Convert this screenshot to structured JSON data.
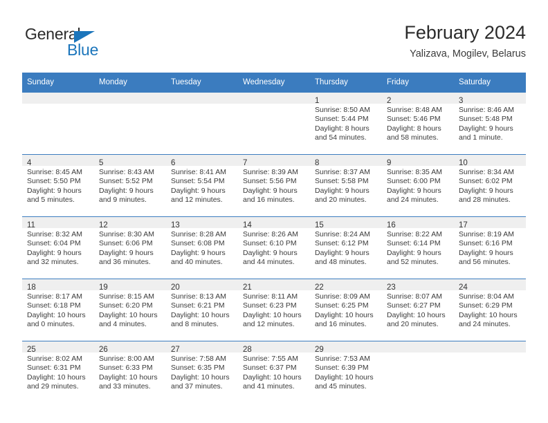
{
  "logo": {
    "word1": "General",
    "word2": "Blue",
    "triangle_color": "#1b75bb",
    "word1_color": "#2b2b2b",
    "word2_color": "#1b75bb"
  },
  "header": {
    "title": "February 2024",
    "subtitle": "Yalizava, Mogilev, Belarus"
  },
  "colors": {
    "header_blue": "#3b7cbf",
    "row_band_gray": "#efefef",
    "text": "#3a3a3a"
  },
  "weekdays": [
    "Sunday",
    "Monday",
    "Tuesday",
    "Wednesday",
    "Thursday",
    "Friday",
    "Saturday"
  ],
  "weeks": [
    [
      {
        "day": "",
        "sunrise": "",
        "sunset": "",
        "daylight1": "",
        "daylight2": ""
      },
      {
        "day": "",
        "sunrise": "",
        "sunset": "",
        "daylight1": "",
        "daylight2": ""
      },
      {
        "day": "",
        "sunrise": "",
        "sunset": "",
        "daylight1": "",
        "daylight2": ""
      },
      {
        "day": "",
        "sunrise": "",
        "sunset": "",
        "daylight1": "",
        "daylight2": ""
      },
      {
        "day": "1",
        "sunrise": "Sunrise: 8:50 AM",
        "sunset": "Sunset: 5:44 PM",
        "daylight1": "Daylight: 8 hours",
        "daylight2": "and 54 minutes."
      },
      {
        "day": "2",
        "sunrise": "Sunrise: 8:48 AM",
        "sunset": "Sunset: 5:46 PM",
        "daylight1": "Daylight: 8 hours",
        "daylight2": "and 58 minutes."
      },
      {
        "day": "3",
        "sunrise": "Sunrise: 8:46 AM",
        "sunset": "Sunset: 5:48 PM",
        "daylight1": "Daylight: 9 hours",
        "daylight2": "and 1 minute."
      }
    ],
    [
      {
        "day": "4",
        "sunrise": "Sunrise: 8:45 AM",
        "sunset": "Sunset: 5:50 PM",
        "daylight1": "Daylight: 9 hours",
        "daylight2": "and 5 minutes."
      },
      {
        "day": "5",
        "sunrise": "Sunrise: 8:43 AM",
        "sunset": "Sunset: 5:52 PM",
        "daylight1": "Daylight: 9 hours",
        "daylight2": "and 9 minutes."
      },
      {
        "day": "6",
        "sunrise": "Sunrise: 8:41 AM",
        "sunset": "Sunset: 5:54 PM",
        "daylight1": "Daylight: 9 hours",
        "daylight2": "and 12 minutes."
      },
      {
        "day": "7",
        "sunrise": "Sunrise: 8:39 AM",
        "sunset": "Sunset: 5:56 PM",
        "daylight1": "Daylight: 9 hours",
        "daylight2": "and 16 minutes."
      },
      {
        "day": "8",
        "sunrise": "Sunrise: 8:37 AM",
        "sunset": "Sunset: 5:58 PM",
        "daylight1": "Daylight: 9 hours",
        "daylight2": "and 20 minutes."
      },
      {
        "day": "9",
        "sunrise": "Sunrise: 8:35 AM",
        "sunset": "Sunset: 6:00 PM",
        "daylight1": "Daylight: 9 hours",
        "daylight2": "and 24 minutes."
      },
      {
        "day": "10",
        "sunrise": "Sunrise: 8:34 AM",
        "sunset": "Sunset: 6:02 PM",
        "daylight1": "Daylight: 9 hours",
        "daylight2": "and 28 minutes."
      }
    ],
    [
      {
        "day": "11",
        "sunrise": "Sunrise: 8:32 AM",
        "sunset": "Sunset: 6:04 PM",
        "daylight1": "Daylight: 9 hours",
        "daylight2": "and 32 minutes."
      },
      {
        "day": "12",
        "sunrise": "Sunrise: 8:30 AM",
        "sunset": "Sunset: 6:06 PM",
        "daylight1": "Daylight: 9 hours",
        "daylight2": "and 36 minutes."
      },
      {
        "day": "13",
        "sunrise": "Sunrise: 8:28 AM",
        "sunset": "Sunset: 6:08 PM",
        "daylight1": "Daylight: 9 hours",
        "daylight2": "and 40 minutes."
      },
      {
        "day": "14",
        "sunrise": "Sunrise: 8:26 AM",
        "sunset": "Sunset: 6:10 PM",
        "daylight1": "Daylight: 9 hours",
        "daylight2": "and 44 minutes."
      },
      {
        "day": "15",
        "sunrise": "Sunrise: 8:24 AM",
        "sunset": "Sunset: 6:12 PM",
        "daylight1": "Daylight: 9 hours",
        "daylight2": "and 48 minutes."
      },
      {
        "day": "16",
        "sunrise": "Sunrise: 8:22 AM",
        "sunset": "Sunset: 6:14 PM",
        "daylight1": "Daylight: 9 hours",
        "daylight2": "and 52 minutes."
      },
      {
        "day": "17",
        "sunrise": "Sunrise: 8:19 AM",
        "sunset": "Sunset: 6:16 PM",
        "daylight1": "Daylight: 9 hours",
        "daylight2": "and 56 minutes."
      }
    ],
    [
      {
        "day": "18",
        "sunrise": "Sunrise: 8:17 AM",
        "sunset": "Sunset: 6:18 PM",
        "daylight1": "Daylight: 10 hours",
        "daylight2": "and 0 minutes."
      },
      {
        "day": "19",
        "sunrise": "Sunrise: 8:15 AM",
        "sunset": "Sunset: 6:20 PM",
        "daylight1": "Daylight: 10 hours",
        "daylight2": "and 4 minutes."
      },
      {
        "day": "20",
        "sunrise": "Sunrise: 8:13 AM",
        "sunset": "Sunset: 6:21 PM",
        "daylight1": "Daylight: 10 hours",
        "daylight2": "and 8 minutes."
      },
      {
        "day": "21",
        "sunrise": "Sunrise: 8:11 AM",
        "sunset": "Sunset: 6:23 PM",
        "daylight1": "Daylight: 10 hours",
        "daylight2": "and 12 minutes."
      },
      {
        "day": "22",
        "sunrise": "Sunrise: 8:09 AM",
        "sunset": "Sunset: 6:25 PM",
        "daylight1": "Daylight: 10 hours",
        "daylight2": "and 16 minutes."
      },
      {
        "day": "23",
        "sunrise": "Sunrise: 8:07 AM",
        "sunset": "Sunset: 6:27 PM",
        "daylight1": "Daylight: 10 hours",
        "daylight2": "and 20 minutes."
      },
      {
        "day": "24",
        "sunrise": "Sunrise: 8:04 AM",
        "sunset": "Sunset: 6:29 PM",
        "daylight1": "Daylight: 10 hours",
        "daylight2": "and 24 minutes."
      }
    ],
    [
      {
        "day": "25",
        "sunrise": "Sunrise: 8:02 AM",
        "sunset": "Sunset: 6:31 PM",
        "daylight1": "Daylight: 10 hours",
        "daylight2": "and 29 minutes."
      },
      {
        "day": "26",
        "sunrise": "Sunrise: 8:00 AM",
        "sunset": "Sunset: 6:33 PM",
        "daylight1": "Daylight: 10 hours",
        "daylight2": "and 33 minutes."
      },
      {
        "day": "27",
        "sunrise": "Sunrise: 7:58 AM",
        "sunset": "Sunset: 6:35 PM",
        "daylight1": "Daylight: 10 hours",
        "daylight2": "and 37 minutes."
      },
      {
        "day": "28",
        "sunrise": "Sunrise: 7:55 AM",
        "sunset": "Sunset: 6:37 PM",
        "daylight1": "Daylight: 10 hours",
        "daylight2": "and 41 minutes."
      },
      {
        "day": "29",
        "sunrise": "Sunrise: 7:53 AM",
        "sunset": "Sunset: 6:39 PM",
        "daylight1": "Daylight: 10 hours",
        "daylight2": "and 45 minutes."
      },
      {
        "day": "",
        "sunrise": "",
        "sunset": "",
        "daylight1": "",
        "daylight2": ""
      },
      {
        "day": "",
        "sunrise": "",
        "sunset": "",
        "daylight1": "",
        "daylight2": ""
      }
    ]
  ]
}
